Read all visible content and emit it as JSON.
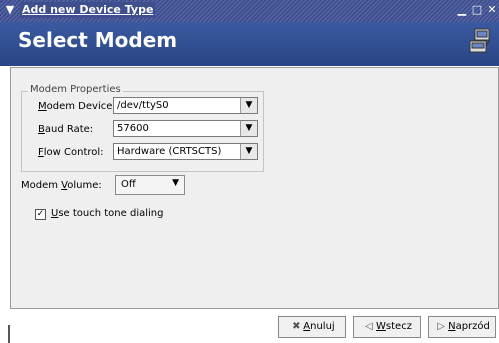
{
  "window": {
    "title": "Add new Device Type",
    "menu_icon": "chevron-down-icon",
    "minimize_glyph": "▁",
    "maximize_glyph": "□",
    "close_glyph": "✕"
  },
  "header": {
    "heading": "Select Modem",
    "icon": "modem-icon",
    "background": "#2e4a8f"
  },
  "modem_properties": {
    "group_label": "Modem Properties",
    "device": {
      "label_prefix": "",
      "label_mnemonic": "M",
      "label_rest": "odem Device:",
      "value": "/dev/ttyS0"
    },
    "baud": {
      "label_mnemonic": "B",
      "label_rest": "aud Rate:",
      "value": "57600"
    },
    "flow": {
      "label_mnemonic": "F",
      "label_rest": "low Control:",
      "value": "Hardware (CRTSCTS)"
    }
  },
  "volume": {
    "label_prefix": "Modem ",
    "label_mnemonic": "V",
    "label_rest": "olume:",
    "value": "Off"
  },
  "touch_tone": {
    "checked": true,
    "label_mnemonic": "U",
    "label_rest": "se touch tone dialing"
  },
  "buttons": {
    "cancel": {
      "icon": "cancel-icon",
      "mnemonic": "A",
      "rest": "nuluj"
    },
    "back": {
      "icon": "back-arrow-icon",
      "mnemonic": "W",
      "rest": "stecz"
    },
    "forward": {
      "icon": "forward-arrow-icon",
      "mnemonic": "N",
      "rest": "aprzód"
    }
  }
}
